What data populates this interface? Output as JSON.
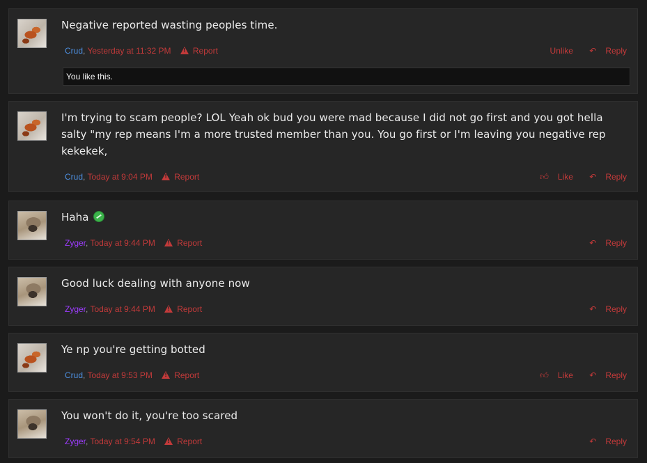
{
  "posts": [
    {
      "avatar": "crud-avatar",
      "message": "Negative reported wasting peoples time.",
      "user": "Crud",
      "time": "Yesterday at 11:32 PM",
      "report": "Report",
      "like_label": "Unlike",
      "reply": "Reply",
      "likes_text": "You like this."
    },
    {
      "avatar": "crud-avatar",
      "message": "I'm trying to scam people? LOL Yeah ok bud you were mad because I did not go first and you got hella salty \"my rep means I'm a more trusted member than you. You go first or I'm leaving you negative rep kekekek,",
      "user": "Crud",
      "time": "Today at 9:04 PM",
      "report": "Report",
      "like_label": "Like",
      "reply": "Reply"
    },
    {
      "avatar": "zyger-avatar",
      "message": "Haha",
      "user": "Zyger",
      "time": "Today at 9:44 PM",
      "report": "Report",
      "reply": "Reply"
    },
    {
      "avatar": "zyger-avatar",
      "message": "Good luck dealing with anyone now",
      "user": "Zyger",
      "time": "Today at 9:44 PM",
      "report": "Report",
      "reply": "Reply"
    },
    {
      "avatar": "crud-avatar",
      "message": "Ye np you're getting botted",
      "user": "Crud",
      "time": "Today at 9:53 PM",
      "report": "Report",
      "like_label": "Like",
      "reply": "Reply"
    },
    {
      "avatar": "zyger-avatar",
      "message": "You won't do it, you're too scared",
      "user": "Zyger",
      "time": "Today at 9:54 PM",
      "report": "Report",
      "reply": "Reply"
    }
  ],
  "colors": {
    "background": "#1b1b1b",
    "post_bg": "#262626",
    "crud_name": "#4d8fe0",
    "zyger_name": "#9d3cff",
    "action_red": "#c23a3a"
  },
  "icons": {
    "report": "warning-triangle-icon",
    "reply": "reply-arrow-icon",
    "like": "thumbs-up-icon",
    "emoji": "green-emoji-icon"
  }
}
